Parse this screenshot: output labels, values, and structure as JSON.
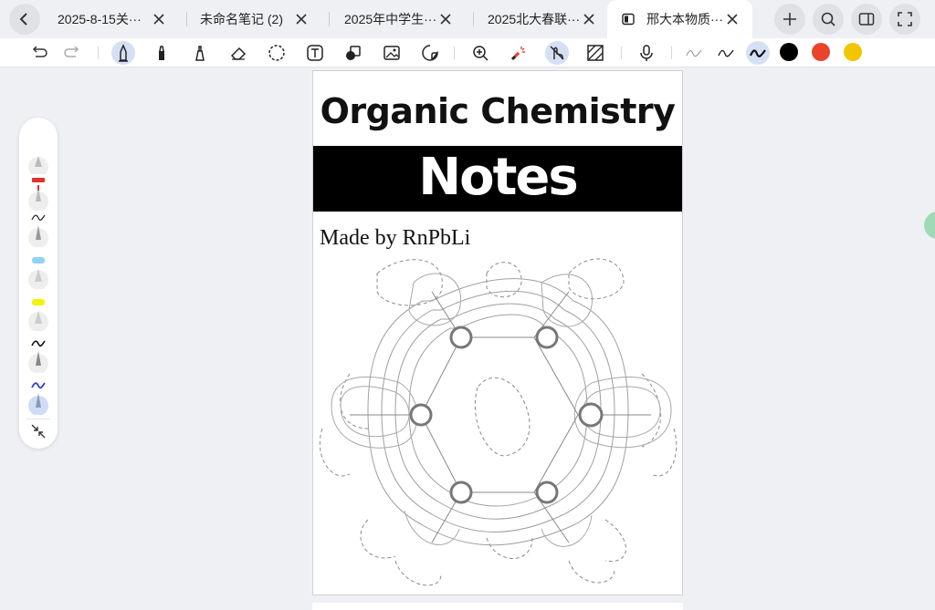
{
  "tabs": [
    {
      "label": "2025-8-15关···",
      "active": false
    },
    {
      "label": "未命名笔记 (2)",
      "active": false
    },
    {
      "label": "2025年中学生···",
      "active": false
    },
    {
      "label": "2025北大春联···",
      "active": false
    },
    {
      "label": "邢大本物质···",
      "active": true
    }
  ],
  "toolbar": {
    "tools": [
      "undo-icon",
      "redo-icon",
      "pen-icon",
      "marker-icon",
      "highlighter-icon",
      "eraser-icon",
      "lasso-icon",
      "text-icon",
      "shape-icon",
      "image-icon",
      "sticker-icon",
      "zoom-icon",
      "laser-icon",
      "hand-touch-icon",
      "pattern-icon",
      "mic-icon",
      "stroke-thin-icon",
      "stroke-medium-icon",
      "stroke-thick-icon"
    ],
    "colors": [
      "#000000",
      "#e8442a",
      "#f2c500"
    ]
  },
  "page": {
    "title": "Organic Chemistry",
    "subtitle": "Notes",
    "author": "Made by RnPbLi"
  }
}
